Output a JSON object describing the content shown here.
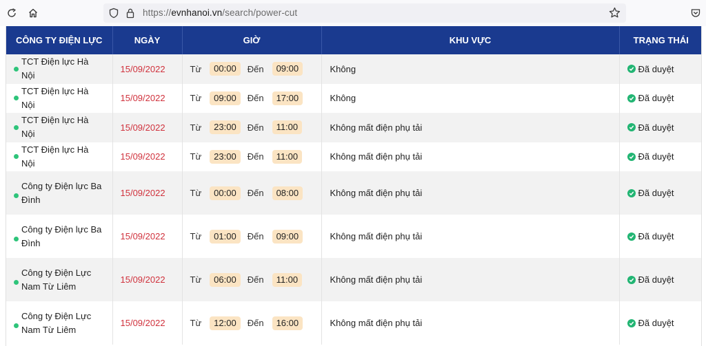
{
  "browser": {
    "url_prefix": "https://",
    "url_host": "evnhanoi.vn",
    "url_path": "/search/power-cut"
  },
  "table": {
    "headers": [
      "CÔNG TY ĐIỆN LỰC",
      "NGÀY",
      "GIỜ",
      "KHU VỰC",
      "TRẠNG THÁI"
    ],
    "from_label": "Từ",
    "to_label": "Đến",
    "rows": [
      {
        "company": "TCT Điện lực Hà Nội",
        "date": "15/09/2022",
        "from": "00:00",
        "to": "09:00",
        "area": "Không",
        "status": "Đã duyệt"
      },
      {
        "company": "TCT Điện lực Hà Nội",
        "date": "15/09/2022",
        "from": "09:00",
        "to": "17:00",
        "area": "Không",
        "status": "Đã duyệt"
      },
      {
        "company": "TCT Điện lực Hà Nội",
        "date": "15/09/2022",
        "from": "23:00",
        "to": "11:00",
        "area": "Không mất điện phụ tải",
        "status": "Đã duyệt"
      },
      {
        "company": "TCT Điện lực Hà Nội",
        "date": "15/09/2022",
        "from": "23:00",
        "to": "11:00",
        "area": "Không mất điện phụ tải",
        "status": "Đã duyệt"
      },
      {
        "company": "Công ty Điện lực Ba Đình",
        "date": "15/09/2022",
        "from": "00:00",
        "to": "08:00",
        "area": "Không mất điện phụ tải",
        "status": "Đã duyệt"
      },
      {
        "company": "Công ty Điện lực Ba Đình",
        "date": "15/09/2022",
        "from": "01:00",
        "to": "09:00",
        "area": "Không mất điện phụ tải",
        "status": "Đã duyệt"
      },
      {
        "company": "Công ty Điện Lực Nam Từ Liêm",
        "date": "15/09/2022",
        "from": "06:00",
        "to": "11:00",
        "area": "Không mất điện phụ tải",
        "status": "Đã duyệt"
      },
      {
        "company": "Công ty Điện Lực Nam Từ Liêm",
        "date": "15/09/2022",
        "from": "12:00",
        "to": "16:00",
        "area": "Không mất điện phụ tải",
        "status": "Đã duyệt"
      }
    ]
  },
  "colors": {
    "header_bg": "#1a3a8f",
    "date_text": "#d0313c",
    "time_pill_bg": "#fbe4c3",
    "status_green": "#22b573",
    "company_dot": "#2ec47a"
  },
  "icons": [
    "reload-icon",
    "home-icon",
    "shield-icon",
    "lock-icon",
    "star-icon",
    "pocket-icon",
    "status-check-icon"
  ]
}
